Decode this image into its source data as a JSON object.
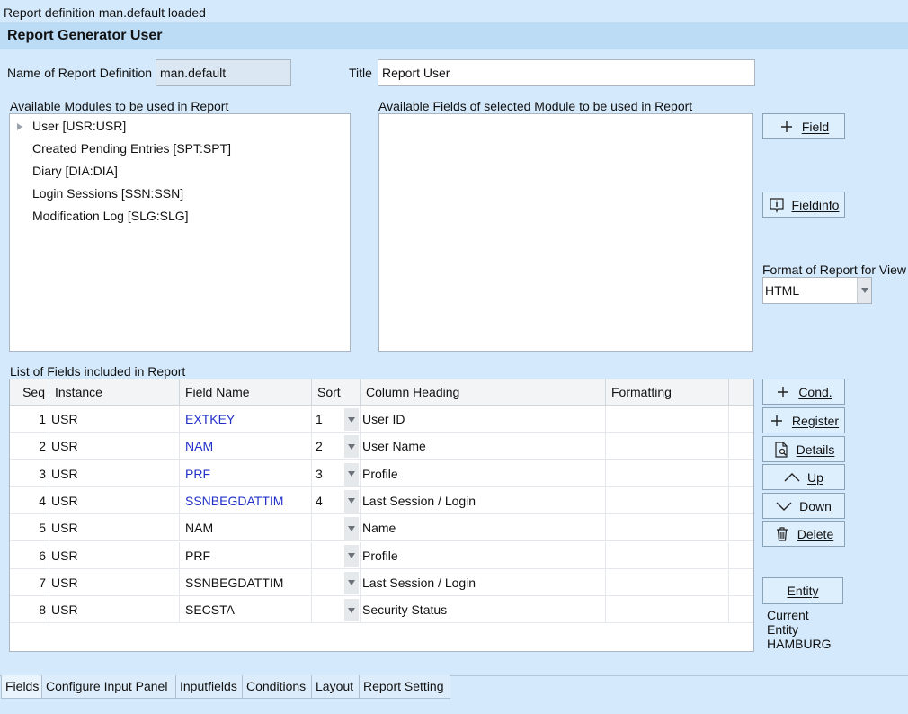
{
  "status": "Report definition man.default loaded",
  "header": {
    "title": "Report Generator User"
  },
  "definition": {
    "label": "Name of Report Definition",
    "value": "man.default"
  },
  "title_field": {
    "label": "Title",
    "value": "Report User"
  },
  "modules": {
    "label": "Available Modules to be used in Report",
    "items": [
      {
        "label": "User [USR:USR]",
        "expandable": true
      },
      {
        "label": "Created Pending Entries [SPT:SPT]",
        "expandable": false
      },
      {
        "label": "Diary [DIA:DIA]",
        "expandable": false
      },
      {
        "label": "Login Sessions [SSN:SSN]",
        "expandable": false
      },
      {
        "label": "Modification Log [SLG:SLG]",
        "expandable": false
      }
    ]
  },
  "fields_panel": {
    "label": "Available Fields of selected Module to be used in Report"
  },
  "buttons": {
    "field": "Field",
    "fieldinfo": "Fieldinfo",
    "cond": "Cond.",
    "register": "Register",
    "details": "Details",
    "up": "Up",
    "down": "Down",
    "delete": "Delete",
    "entity": "Entity"
  },
  "format": {
    "label": "Format of Report for View",
    "value": "HTML"
  },
  "list": {
    "label": "List of Fields included in Report",
    "columns": [
      "Seq",
      "Instance",
      "Field Name",
      "Sort",
      "Column Heading",
      "Formatting"
    ],
    "rows": [
      {
        "seq": "1",
        "instance": "USR",
        "field": "EXTKEY",
        "sort": "1",
        "heading": "User ID",
        "linked": true
      },
      {
        "seq": "2",
        "instance": "USR",
        "field": "NAM",
        "sort": "2",
        "heading": "User Name",
        "linked": true
      },
      {
        "seq": "3",
        "instance": "USR",
        "field": "PRF",
        "sort": "3",
        "heading": "Profile",
        "linked": true
      },
      {
        "seq": "4",
        "instance": "USR",
        "field": "SSNBEGDATTIM",
        "sort": "4",
        "heading": "Last Session / Login",
        "linked": true
      },
      {
        "seq": "5",
        "instance": "USR",
        "field": "NAM",
        "sort": "",
        "heading": "Name",
        "linked": false
      },
      {
        "seq": "6",
        "instance": "USR",
        "field": "PRF",
        "sort": "",
        "heading": "Profile",
        "linked": false
      },
      {
        "seq": "7",
        "instance": "USR",
        "field": "SSNBEGDATTIM",
        "sort": "",
        "heading": "Last Session / Login",
        "linked": false
      },
      {
        "seq": "8",
        "instance": "USR",
        "field": "SECSTA",
        "sort": "",
        "heading": "Security Status",
        "linked": false
      }
    ]
  },
  "entity": {
    "line1": "Current",
    "line2": "Entity",
    "value": "HAMBURG"
  },
  "tabs": [
    "Fields",
    "Configure Input Panel",
    "Inputfields",
    "Conditions",
    "Layout",
    "Report Setting"
  ],
  "colors": {
    "background": "#d4e9fb",
    "header": "#bcdcf6",
    "link": "#2231c8"
  }
}
